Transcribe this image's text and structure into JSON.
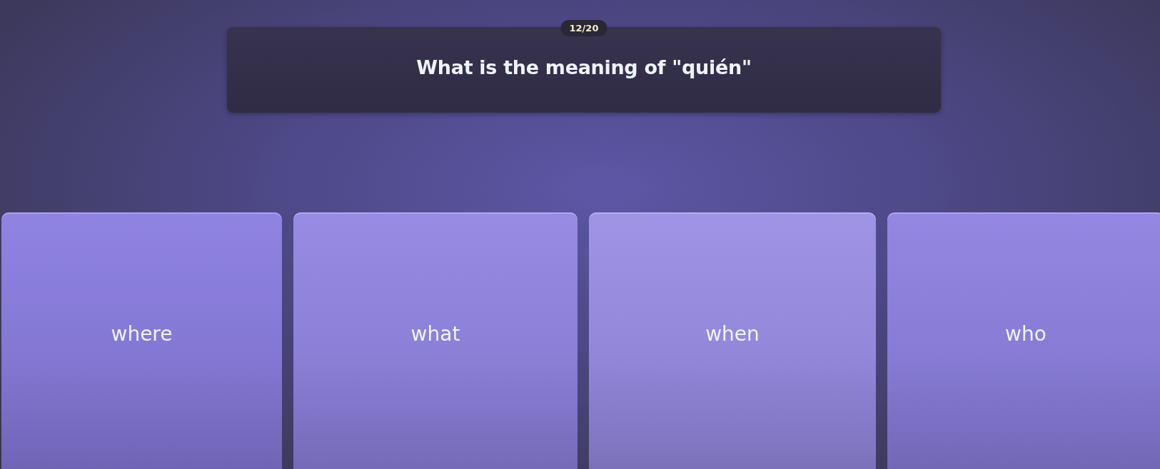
{
  "counter": "12/20",
  "question": "What is the meaning of \"quién\"",
  "answers": [
    {
      "label": "where"
    },
    {
      "label": "what"
    },
    {
      "label": "when"
    },
    {
      "label": "who"
    }
  ]
}
